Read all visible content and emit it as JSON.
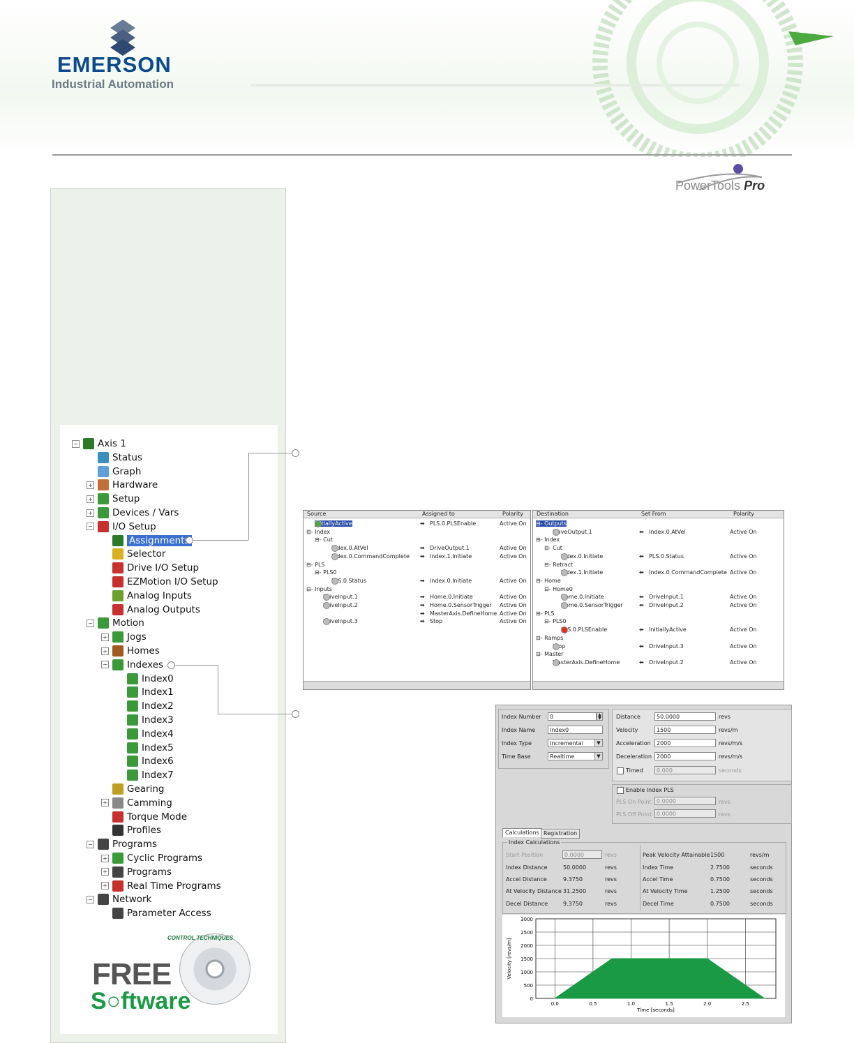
{
  "header": {
    "brand": "EMERSON",
    "brand_sub": "Industrial Automation",
    "product_logo_a": "PowerTools",
    "product_logo_b": "Pro"
  },
  "tree": [
    {
      "label": "Axis 1",
      "level": 0,
      "pm": "-",
      "icon": "axis-icon",
      "color": "#2a7a2a"
    },
    {
      "label": "Status",
      "level": 1,
      "pm": "",
      "icon": "status-icon",
      "color": "#3a8fbf"
    },
    {
      "label": "Graph",
      "level": 1,
      "pm": "",
      "icon": "graph-icon",
      "color": "#5fa0d8"
    },
    {
      "label": "Hardware",
      "level": 1,
      "pm": "+",
      "icon": "hardware-icon",
      "color": "#c0703a"
    },
    {
      "label": "Setup",
      "level": 1,
      "pm": "+",
      "icon": "setup-icon",
      "color": "#3a9a3a"
    },
    {
      "label": "Devices / Vars",
      "level": 1,
      "pm": "+",
      "icon": "devices-icon",
      "color": "#3a9a3a"
    },
    {
      "label": "I/O Setup",
      "level": 1,
      "pm": "-",
      "icon": "io-setup-icon",
      "color": "#c83030"
    },
    {
      "label": "Assignments",
      "level": 2,
      "pm": "",
      "icon": "assignments-icon",
      "color": "#2a7a2a",
      "selected": true
    },
    {
      "label": "Selector",
      "level": 2,
      "pm": "",
      "icon": "selector-icon",
      "color": "#d8b020"
    },
    {
      "label": "Drive I/O Setup",
      "level": 2,
      "pm": "",
      "icon": "drive-io-icon",
      "color": "#c83030"
    },
    {
      "label": "EZMotion I/O Setup",
      "level": 2,
      "pm": "",
      "icon": "ezmotion-io-icon",
      "color": "#c83030"
    },
    {
      "label": "Analog Inputs",
      "level": 2,
      "pm": "",
      "icon": "analog-inputs-icon",
      "color": "#6aa030"
    },
    {
      "label": "Analog Outputs",
      "level": 2,
      "pm": "",
      "icon": "analog-outputs-icon",
      "color": "#c83030"
    },
    {
      "label": "Motion",
      "level": 1,
      "pm": "-",
      "icon": "motion-icon",
      "color": "#3a9a3a"
    },
    {
      "label": "Jogs",
      "level": 2,
      "pm": "+",
      "icon": "jogs-icon",
      "color": "#3a9a3a"
    },
    {
      "label": "Homes",
      "level": 2,
      "pm": "+",
      "icon": "homes-icon",
      "color": "#a05a20"
    },
    {
      "label": "Indexes",
      "level": 2,
      "pm": "-",
      "icon": "indexes-icon",
      "color": "#3a9a3a"
    },
    {
      "label": "Index0",
      "level": 3,
      "pm": "",
      "icon": "index-icon",
      "color": "#3a9a3a"
    },
    {
      "label": "Index1",
      "level": 3,
      "pm": "",
      "icon": "index-icon",
      "color": "#3a9a3a"
    },
    {
      "label": "Index2",
      "level": 3,
      "pm": "",
      "icon": "index-icon",
      "color": "#3a9a3a"
    },
    {
      "label": "Index3",
      "level": 3,
      "pm": "",
      "icon": "index-icon",
      "color": "#3a9a3a"
    },
    {
      "label": "Index4",
      "level": 3,
      "pm": "",
      "icon": "index-icon",
      "color": "#3a9a3a"
    },
    {
      "label": "Index5",
      "level": 3,
      "pm": "",
      "icon": "index-icon",
      "color": "#3a9a3a"
    },
    {
      "label": "Index6",
      "level": 3,
      "pm": "",
      "icon": "index-icon",
      "color": "#3a9a3a"
    },
    {
      "label": "Index7",
      "level": 3,
      "pm": "",
      "icon": "index-icon",
      "color": "#3a9a3a"
    },
    {
      "label": "Gearing",
      "level": 2,
      "pm": "",
      "icon": "gearing-icon",
      "color": "#c0a020"
    },
    {
      "label": "Camming",
      "level": 2,
      "pm": "+",
      "icon": "camming-icon",
      "color": "#888"
    },
    {
      "label": "Torque Mode",
      "level": 2,
      "pm": "",
      "icon": "torque-icon",
      "color": "#c83030"
    },
    {
      "label": "Profiles",
      "level": 2,
      "pm": "",
      "icon": "profiles-icon",
      "color": "#333"
    },
    {
      "label": "Programs",
      "level": 1,
      "pm": "-",
      "icon": "programs-icon",
      "color": "#444"
    },
    {
      "label": "Cyclic Programs",
      "level": 2,
      "pm": "+",
      "icon": "cyclic-programs-icon",
      "color": "#3a9a3a"
    },
    {
      "label": "Programs",
      "level": 2,
      "pm": "+",
      "icon": "programs-icon",
      "color": "#444"
    },
    {
      "label": "Real Time Programs",
      "level": 2,
      "pm": "+",
      "icon": "realtime-programs-icon",
      "color": "#c83030"
    },
    {
      "label": "Network",
      "level": 1,
      "pm": "-",
      "icon": "network-icon",
      "color": "#444"
    },
    {
      "label": "Parameter Access",
      "level": 2,
      "pm": "",
      "icon": "parameter-access-icon",
      "color": "#444"
    }
  ],
  "promo": {
    "ct": "CONTROL TECHNIQUES",
    "free": "FREE",
    "software": "S○ftware"
  },
  "assign_left": {
    "headers": [
      "Source",
      "Assigned to",
      "Polarity"
    ],
    "rows": [
      {
        "indent": 1,
        "src": "InitiallyActive",
        "dot": "green",
        "sel": true,
        "arrow": "➡",
        "to": "PLS.0.PLSEnable",
        "pol": "Active On"
      },
      {
        "indent": 0,
        "src": "⊟- Index",
        "dot": "",
        "arrow": "",
        "to": "",
        "pol": ""
      },
      {
        "indent": 1,
        "src": "⊟- Cut",
        "dot": "",
        "arrow": "",
        "to": "",
        "pol": ""
      },
      {
        "indent": 3,
        "src": "Index.0.AtVel",
        "dot": "grey",
        "arrow": "➡",
        "to": "DriveOutput.1",
        "pol": "Active On"
      },
      {
        "indent": 3,
        "src": "Index.0.CommandComplete",
        "dot": "grey",
        "arrow": "➡",
        "to": "Index.1.Initiate",
        "pol": "Active On"
      },
      {
        "indent": 0,
        "src": "⊟- PLS",
        "dot": "",
        "arrow": "",
        "to": "",
        "pol": ""
      },
      {
        "indent": 1,
        "src": "⊟- PLS0",
        "dot": "",
        "arrow": "",
        "to": "",
        "pol": ""
      },
      {
        "indent": 3,
        "src": "PLS.0.Status",
        "dot": "grey",
        "arrow": "➡",
        "to": "Index.0.Initiate",
        "pol": "Active On"
      },
      {
        "indent": 0,
        "src": "⊟- Inputs",
        "dot": "",
        "arrow": "",
        "to": "",
        "pol": ""
      },
      {
        "indent": 2,
        "src": "DriveInput.1",
        "dot": "grey",
        "arrow": "➡",
        "to": "Home.0.Initiate",
        "pol": "Active On"
      },
      {
        "indent": 2,
        "src": "DriveInput.2",
        "dot": "grey",
        "arrow": "➡",
        "to": "Home.0.SensorTrigger",
        "pol": "Active On"
      },
      {
        "indent": 2,
        "src": "",
        "dot": "",
        "arrow": "➡",
        "to": "MasterAxis.DefineHome",
        "pol": "Active On"
      },
      {
        "indent": 2,
        "src": "DriveInput.3",
        "dot": "grey",
        "arrow": "➡",
        "to": "Stop",
        "pol": "Active On"
      }
    ]
  },
  "assign_right": {
    "headers": [
      "Destination",
      "Set From",
      "Polarity"
    ],
    "rows": [
      {
        "indent": 0,
        "dst": "⊟- Outputs",
        "dot": "",
        "sel": true,
        "arrow": "",
        "from": "",
        "pol": ""
      },
      {
        "indent": 2,
        "dst": "DriveOutput.1",
        "dot": "grey",
        "arrow": "⬅",
        "from": "Index.0.AtVel",
        "pol": "Active On"
      },
      {
        "indent": 0,
        "dst": "⊟- Index",
        "dot": "",
        "arrow": "",
        "from": "",
        "pol": ""
      },
      {
        "indent": 1,
        "dst": "⊟- Cut",
        "dot": "",
        "arrow": "",
        "from": "",
        "pol": ""
      },
      {
        "indent": 3,
        "dst": "Index.0.Initiate",
        "dot": "grey",
        "arrow": "⬅",
        "from": "PLS.0.Status",
        "pol": "Active On"
      },
      {
        "indent": 1,
        "dst": "⊟- Retract",
        "dot": "",
        "arrow": "",
        "from": "",
        "pol": ""
      },
      {
        "indent": 3,
        "dst": "Index.1.Initiate",
        "dot": "grey",
        "arrow": "⬅",
        "from": "Index.0.CommandComplete",
        "pol": "Active On"
      },
      {
        "indent": 0,
        "dst": "⊟- Home",
        "dot": "",
        "arrow": "",
        "from": "",
        "pol": ""
      },
      {
        "indent": 1,
        "dst": "⊟- Home0",
        "dot": "",
        "arrow": "",
        "from": "",
        "pol": ""
      },
      {
        "indent": 3,
        "dst": "Home.0.Initiate",
        "dot": "grey",
        "arrow": "⬅",
        "from": "DriveInput.1",
        "pol": "Active On"
      },
      {
        "indent": 3,
        "dst": "Home.0.SensorTrigger",
        "dot": "grey",
        "arrow": "⬅",
        "from": "DriveInput.2",
        "pol": "Active On"
      },
      {
        "indent": 0,
        "dst": "⊟- PLS",
        "dot": "",
        "arrow": "",
        "from": "",
        "pol": ""
      },
      {
        "indent": 1,
        "dst": "⊟- PLS0",
        "dot": "",
        "arrow": "",
        "from": "",
        "pol": ""
      },
      {
        "indent": 3,
        "dst": "PLS.0.PLSEnable",
        "dot": "red",
        "arrow": "⬅",
        "from": "InitiallyActive",
        "pol": "Active On"
      },
      {
        "indent": 0,
        "dst": "⊟- Ramps",
        "dot": "",
        "arrow": "",
        "from": "",
        "pol": ""
      },
      {
        "indent": 2,
        "dst": "Stop",
        "dot": "grey",
        "arrow": "⬅",
        "from": "DriveInput.3",
        "pol": "Active On"
      },
      {
        "indent": 0,
        "dst": "⊟- Master",
        "dot": "",
        "arrow": "",
        "from": "",
        "pol": ""
      },
      {
        "indent": 2,
        "dst": "MasterAxis.DefineHome",
        "dot": "grey",
        "arrow": "⬅",
        "from": "DriveInput.2",
        "pol": "Active On"
      }
    ]
  },
  "index_form": {
    "number_label": "Index Number",
    "number": "0",
    "name_label": "Index Name",
    "name": "Index0",
    "type_label": "Index Type",
    "type": "Incremental",
    "timebase_label": "Time Base",
    "timebase": "Realtime",
    "distance_label": "Distance",
    "distance": "50.0000",
    "distance_unit": "revs",
    "velocity_label": "Velocity",
    "velocity": "1500",
    "velocity_unit": "revs/m",
    "accel_label": "Acceleration",
    "accel": "2000",
    "accel_unit": "revs/m/s",
    "decel_label": "Deceleration",
    "decel": "2000",
    "decel_unit": "revs/m/s",
    "timed_label": "Timed",
    "timed": "0.000",
    "timed_unit": "seconds",
    "pls_label": "Enable Index PLS",
    "pls_on_label": "PLS On Point",
    "pls_on": "0.0000",
    "pls_on_unit": "revs",
    "pls_off_label": "PLS Off Point",
    "pls_off": "0.0000",
    "pls_off_unit": "revs",
    "tab1": "Calculations",
    "tab2": "Registration",
    "calc_group": "Index Calculations",
    "start_label": "Start Position",
    "start": "0.0000",
    "start_unit": "revs",
    "idxdist_label": "Index Distance",
    "idxdist": "50.0000",
    "idxdist_unit": "revs",
    "accdist_label": "Accel Distance",
    "accdist": "9.3750",
    "accdist_unit": "revs",
    "veldist_label": "At Velocity Distance",
    "veldist": "31.2500",
    "veldist_unit": "revs",
    "decdist_label": "Decel Distance",
    "decdist": "9.3750",
    "decdist_unit": "revs",
    "peak_label": "Peak Velocity Attainable",
    "peak": "1500",
    "peak_unit": "revs/m",
    "idxtime_label": "Index Time",
    "idxtime": "2.7500",
    "idxtime_unit": "seconds",
    "acctime_label": "Accel Time",
    "acctime": "0.7500",
    "acctime_unit": "seconds",
    "veltime_label": "At Velocity Time",
    "veltime": "1.2500",
    "veltime_unit": "seconds",
    "dectime_label": "Decel Time",
    "dectime": "0.7500",
    "dectime_unit": "seconds"
  },
  "chart_data": {
    "type": "area",
    "x": [
      0,
      0.75,
      2.0,
      2.75
    ],
    "y": [
      0,
      1500,
      1500,
      0
    ],
    "xlabel": "Time [seconds]",
    "ylabel": "Velocity [revs/m]",
    "xlim": [
      -0.25,
      2.9
    ],
    "ylim": [
      0,
      3000
    ],
    "xticks": [
      "0.0",
      "0.5",
      "1.0",
      "1.5",
      "2.0",
      "2.5"
    ],
    "yticks": [
      "0",
      "500",
      "1000",
      "1500",
      "2000",
      "2500",
      "3000"
    ],
    "fill": "#1a9a45",
    "grid": true
  },
  "colors": {
    "accent": "#0b4a8b",
    "green": "#1a9a45",
    "select": "#3a6fd0"
  }
}
